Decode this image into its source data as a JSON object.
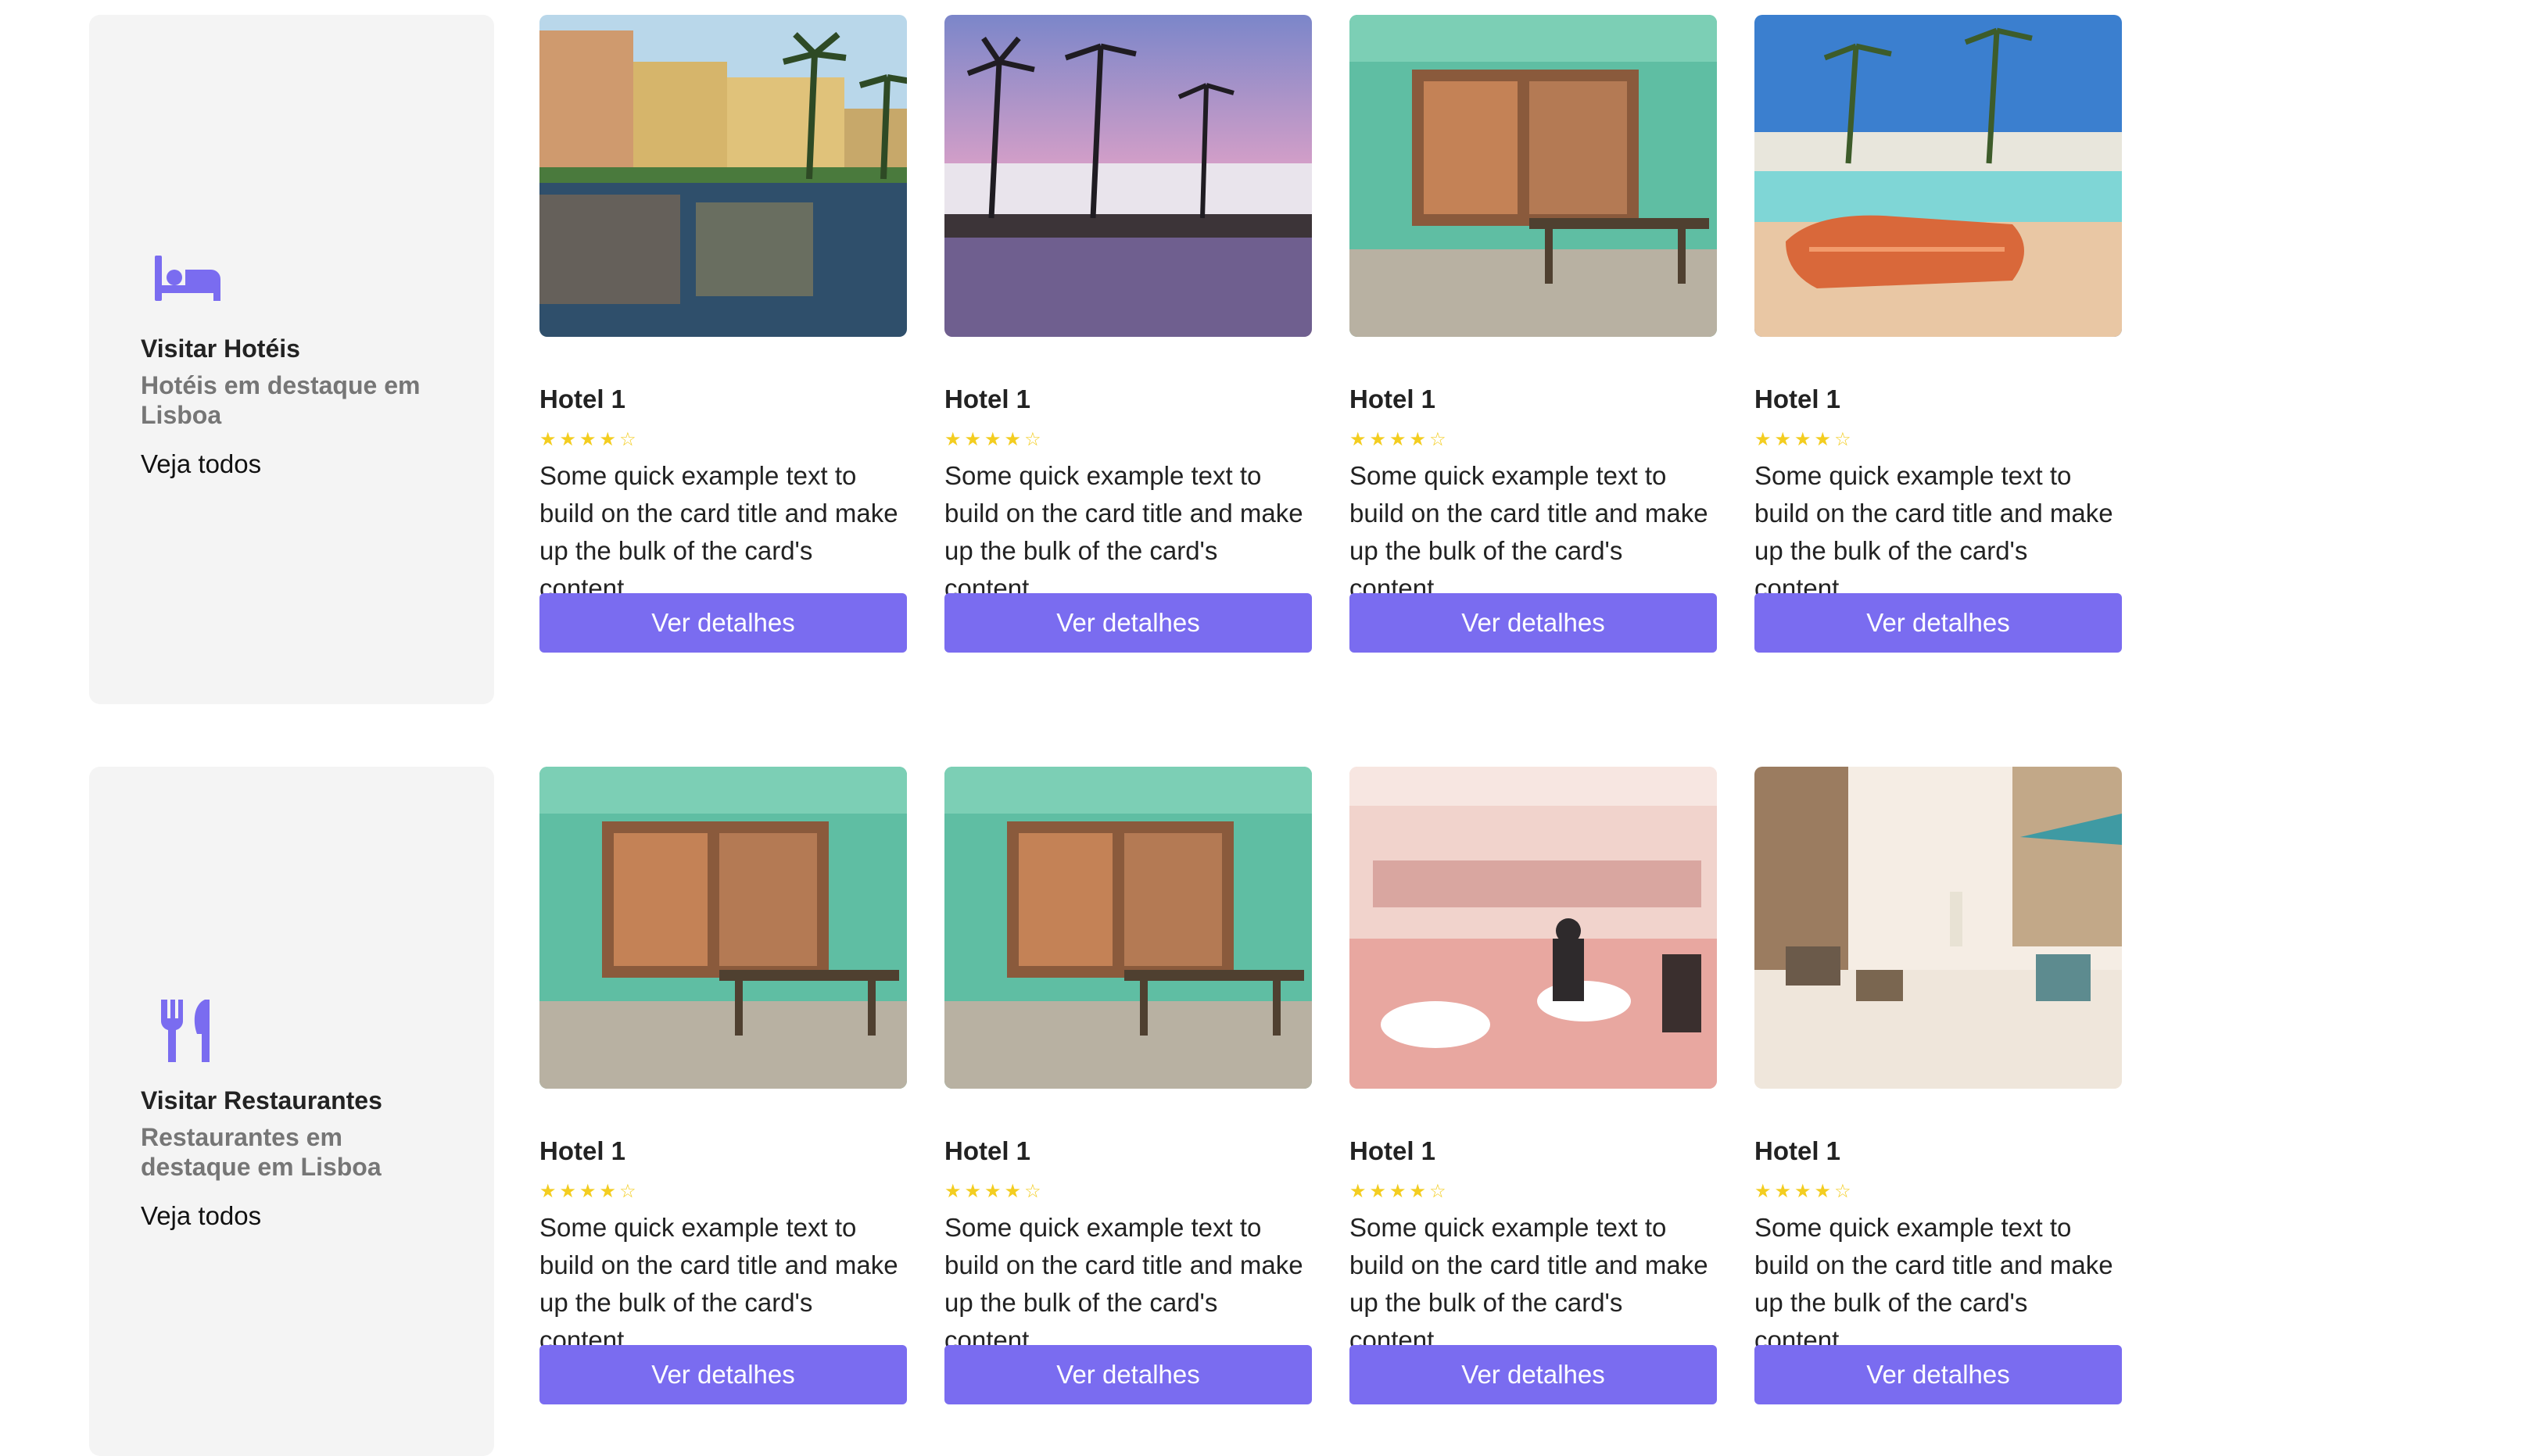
{
  "colors": {
    "accent": "#7a6cf0",
    "star": "#f3cd20",
    "panel_bg": "#f4f4f4"
  },
  "sections": [
    {
      "icon": "bed-icon",
      "title": "Visitar Hotéis",
      "subtitle": "Hotéis em destaque em Lisboa",
      "link": "Veja todos",
      "cards": [
        {
          "image": "hotel-pool-reflection-image",
          "title": "Hotel 1",
          "rating": 4,
          "stars": "★★★★☆",
          "text": "Some quick example text to build on the card title and make up the bulk of the card's content.",
          "button": "Ver detalhes"
        },
        {
          "image": "palm-pool-sunset-image",
          "title": "Hotel 1",
          "rating": 4,
          "stars": "★★★★☆",
          "text": "Some quick example text to build on the card title and make up the bulk of the card's content.",
          "button": "Ver detalhes"
        },
        {
          "image": "green-storefront-image",
          "title": "Hotel 1",
          "rating": 4,
          "stars": "★★★★☆",
          "text": "Some quick example text to build on the card title and make up the bulk of the card's content.",
          "button": "Ver detalhes"
        },
        {
          "image": "pool-lounger-image",
          "title": "Hotel 1",
          "rating": 4,
          "stars": "★★★★☆",
          "text": "Some quick example text to build on the card title and make up the bulk of the card's content.",
          "button": "Ver detalhes"
        }
      ]
    },
    {
      "icon": "utensils-icon",
      "title": "Visitar Restaurantes",
      "subtitle": "Restaurantes em destaque em Lisboa",
      "link": "Veja todos",
      "cards": [
        {
          "image": "green-storefront-image",
          "title": "Hotel 1",
          "rating": 4,
          "stars": "★★★★☆",
          "text": "Some quick example text to build on the card title and make up the bulk of the card's content.",
          "button": "Ver detalhes"
        },
        {
          "image": "green-storefront-image",
          "title": "Hotel 1",
          "rating": 4,
          "stars": "★★★★☆",
          "text": "Some quick example text to build on the card title and make up the bulk of the card's content.",
          "button": "Ver detalhes"
        },
        {
          "image": "pink-restaurant-interior-image",
          "title": "Hotel 1",
          "rating": 4,
          "stars": "★★★★☆",
          "text": "Some quick example text to build on the card title and make up the bulk of the card's content.",
          "button": "Ver detalhes"
        },
        {
          "image": "street-cafe-image",
          "title": "Hotel 1",
          "rating": 4,
          "stars": "★★★★☆",
          "text": "Some quick example text to build on the card title and make up the bulk of the card's content.",
          "button": "Ver detalhes"
        }
      ]
    }
  ]
}
